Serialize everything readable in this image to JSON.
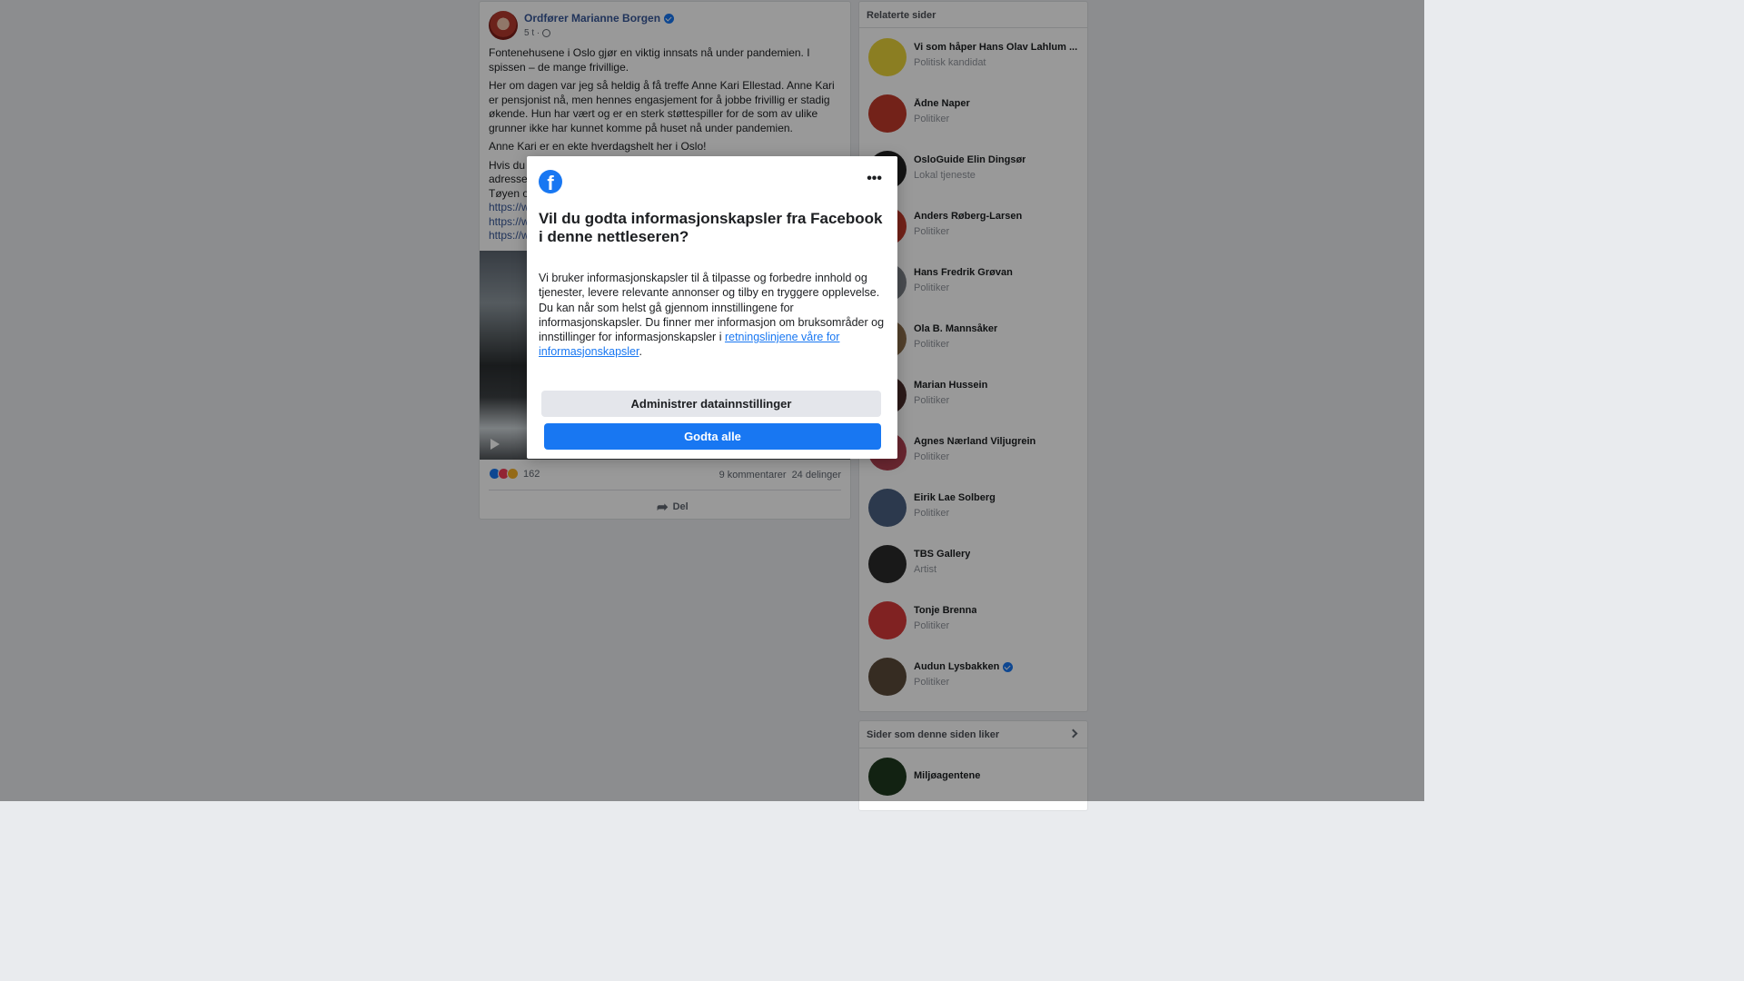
{
  "post": {
    "author": "Ordfører Marianne Borgen",
    "time": "5 t ·",
    "paragraphs": [
      "Fontenehusene i Oslo gjør en viktig innsats nå under pandemien. I spissen – de mange frivillige.",
      "Her om dagen var jeg så heldig å få treffe Anne Kari Ellestad. Anne Kari er pensjonist nå, men hennes engasjement for å jobbe frivillig er stadig økende. Hun har vært og er en sterk støttespiller for de som av ulike grunner ikke har kunnet komme på huset nå under pandemien.",
      "Anne Kari er en ekte hverdagshelt her i Oslo!"
    ],
    "truncated_lines": [
      "Hvis du",
      "adresser",
      "Tøyen o"
    ],
    "links": [
      "https://w",
      "https://w",
      "https://w"
    ],
    "reaction_count": "162",
    "comments": "9 kommentarer",
    "shares": "24 delinger",
    "share_label": "Del"
  },
  "sidebar": {
    "title": "Relaterte sider",
    "items": [
      {
        "name": "Vi som håper Hans Olav Lahlum ...",
        "category": "Politisk kandidat",
        "color": "#e8d23a"
      },
      {
        "name": "Ådne Naper",
        "category": "Politiker",
        "color": "#c0392b"
      },
      {
        "name": "OsloGuide Elin Dingsør",
        "category": "Lokal tjeneste",
        "color": "#222222"
      },
      {
        "name": "Anders Røberg-Larsen",
        "category": "Politiker",
        "color": "#c0392b"
      },
      {
        "name": "Hans Fredrik Grøvan",
        "category": "Politiker",
        "color": "#7a7f85"
      },
      {
        "name": "Ola B. Mannsåker",
        "category": "Politiker",
        "color": "#8a6d4a"
      },
      {
        "name": "Marian Hussein",
        "category": "Politiker",
        "color": "#4a2c2a"
      },
      {
        "name": "Agnes Nærland Viljugrein",
        "category": "Politiker",
        "color": "#b04050"
      },
      {
        "name": "Eirik Lae Solberg",
        "category": "Politiker",
        "color": "#4a6080"
      },
      {
        "name": "TBS Gallery",
        "category": "Artist",
        "color": "#2b2b2b"
      },
      {
        "name": "Tonje Brenna",
        "category": "Politiker",
        "color": "#d63a3a"
      },
      {
        "name": "Audun Lysbakken",
        "category": "Politiker",
        "color": "#5a4a3a"
      }
    ]
  },
  "liked_pages": {
    "title": "Sider som denne siden liker",
    "items": [
      {
        "name": "Miljøagentene",
        "color": "#1e3a1e"
      }
    ]
  },
  "dialog": {
    "title": "Vil du godta informasjonskapsler fra Facebook i denne nettleseren?",
    "body": "Vi bruker informasjonskapsler til å tilpasse og forbedre innhold og tjenester, levere relevante annonser og tilby en tryggere opplevelse. Du kan når som helst gå gjennom innstillingene for informasjonskapsler. Du finner mer informasjon om bruksområder og innstillinger for informasjonskapsler i ",
    "link_text": "retningslinjene våre for informasjonskapsler",
    "body_end": ".",
    "manage_button": "Administrer datainnstillinger",
    "accept_button": "Godta alle"
  }
}
